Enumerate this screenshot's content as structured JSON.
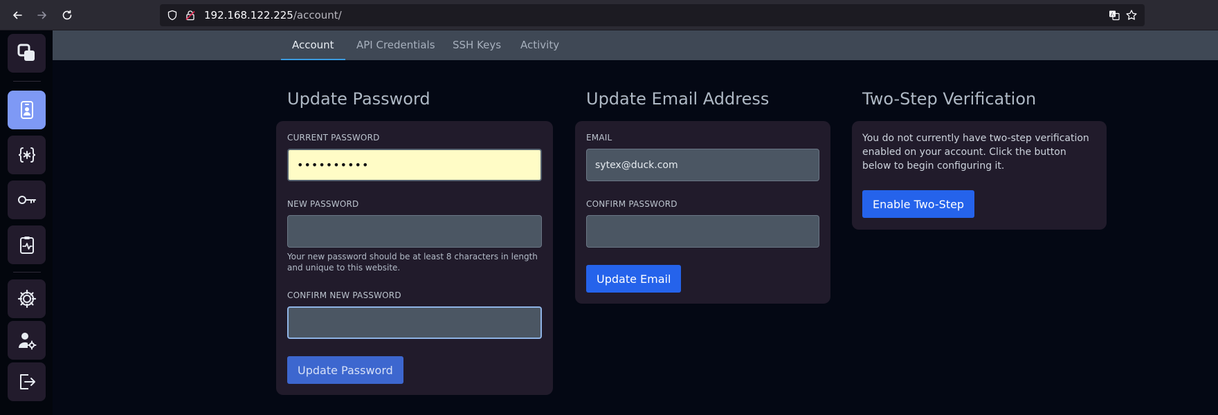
{
  "browser": {
    "url_host": "192.168.122.225",
    "url_path": "/account/"
  },
  "sidebar": {
    "items": [
      {
        "name": "logo",
        "icon": "logo-icon"
      },
      {
        "name": "account",
        "icon": "account-badge-icon",
        "active": true
      },
      {
        "name": "api-credentials",
        "icon": "code-braces-icon"
      },
      {
        "name": "ssh-keys",
        "icon": "key-icon"
      },
      {
        "name": "activity",
        "icon": "clipboard-pulse-icon"
      },
      {
        "name": "admin",
        "icon": "gear-icon"
      },
      {
        "name": "user-settings",
        "icon": "user-cog-icon"
      },
      {
        "name": "logout",
        "icon": "logout-icon"
      }
    ]
  },
  "tabs": [
    {
      "label": "Account",
      "active": true
    },
    {
      "label": "API Credentials"
    },
    {
      "label": "SSH Keys"
    },
    {
      "label": "Activity"
    }
  ],
  "password": {
    "title": "Update Password",
    "current_label": "CURRENT PASSWORD",
    "current_value": "••••••••••",
    "new_label": "NEW PASSWORD",
    "hint": "Your new password should be at least 8 characters in length and unique to this website.",
    "confirm_label": "CONFIRM NEW PASSWORD",
    "button": "Update Password"
  },
  "email": {
    "title": "Update Email Address",
    "email_label": "EMAIL",
    "email_value": "sytex@duck.com",
    "confirm_label": "CONFIRM PASSWORD",
    "button": "Update Email"
  },
  "twostep": {
    "title": "Two-Step Verification",
    "description": "You do not currently have two-step verification enabled on your account. Click the button below to begin configuring it.",
    "button": "Enable Two-Step"
  },
  "colors": {
    "accent": "#2563eb",
    "sidebar_active": "#7e99f5",
    "card": "#211b2b",
    "tab_indicator": "#3b9be0"
  }
}
